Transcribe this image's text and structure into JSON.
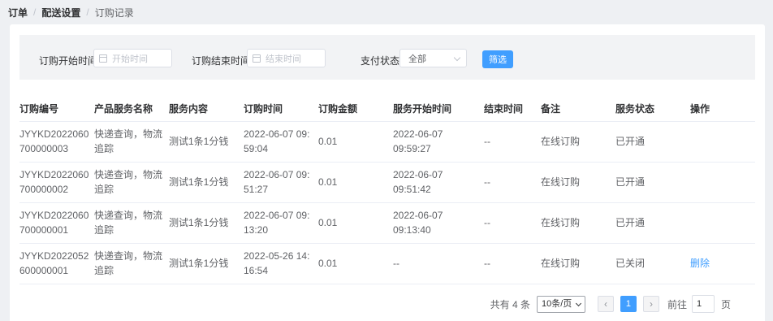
{
  "breadcrumb": [
    "订单",
    "配送设置",
    "订购记录"
  ],
  "filters": {
    "start_label": "订购开始时间",
    "start_placeholder": "开始时间",
    "end_label": "订购结束时间",
    "end_placeholder": "结束时间",
    "status_label": "支付状态",
    "status_value": "全部",
    "filter_button": "筛选"
  },
  "table": {
    "headers": [
      "订购编号",
      "产品服务名称",
      "服务内容",
      "订购时间",
      "订购金额",
      "服务开始时间",
      "结束时间",
      "备注",
      "服务状态",
      "操作"
    ],
    "rows": [
      {
        "id": "JYYKD2022060700000003",
        "product": "快递查询，物流追踪",
        "content": "测试1条1分钱",
        "order_time": "2022-06-07 09:59:04",
        "amount": "0.01",
        "start_time": "2022-06-07 09:59:27",
        "end_time": "--",
        "remark": "在线订购",
        "status": "已开通",
        "action": ""
      },
      {
        "id": "JYYKD2022060700000002",
        "product": "快递查询，物流追踪",
        "content": "测试1条1分钱",
        "order_time": "2022-06-07 09:51:27",
        "amount": "0.01",
        "start_time": "2022-06-07 09:51:42",
        "end_time": "--",
        "remark": "在线订购",
        "status": "已开通",
        "action": ""
      },
      {
        "id": "JYYKD2022060700000001",
        "product": "快递查询，物流追踪",
        "content": "测试1条1分钱",
        "order_time": "2022-06-07 09:13:20",
        "amount": "0.01",
        "start_time": "2022-06-07 09:13:40",
        "end_time": "--",
        "remark": "在线订购",
        "status": "已开通",
        "action": ""
      },
      {
        "id": "JYYKD2022052600000001",
        "product": "快递查询，物流追踪",
        "content": "测试1条1分钱",
        "order_time": "2022-05-26 14:16:54",
        "amount": "0.01",
        "start_time": "--",
        "end_time": "--",
        "remark": "在线订购",
        "status": "已关闭",
        "action": "删除"
      }
    ]
  },
  "pagination": {
    "total": "共有 4 条",
    "page_size": "10条/页",
    "prev": "‹",
    "current": "1",
    "next": "›",
    "goto_label": "前往",
    "goto_value": "1",
    "page_suffix": "页"
  },
  "colors": {
    "primary": "#409eff",
    "background": "#eef0f3"
  }
}
